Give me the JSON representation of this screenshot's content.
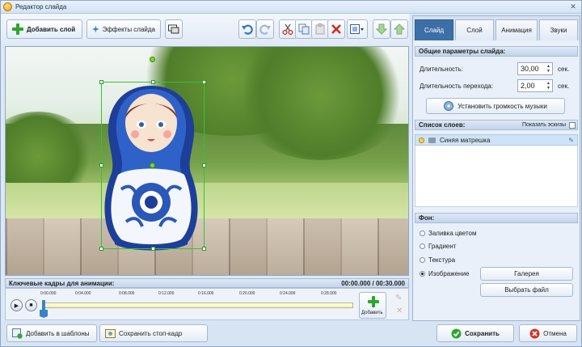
{
  "window": {
    "title": "Редактор слайда",
    "close": "✕"
  },
  "toolbar": {
    "add_layer": "Добавить слой",
    "slide_effects": "Эффекты слайда"
  },
  "tabs": [
    {
      "label": "Слайд",
      "active": true
    },
    {
      "label": "Слой",
      "active": false
    },
    {
      "label": "Анимация",
      "active": false
    },
    {
      "label": "Звуки",
      "active": false
    }
  ],
  "slide_params": {
    "header": "Общие параметры слайда:",
    "duration_label": "Длительность:",
    "duration_value": "30,00",
    "duration_unit": "сек.",
    "transition_label": "Длительность перехода:",
    "transition_value": "2,00",
    "transition_unit": "сек.",
    "music_button": "Установить громкость музыки"
  },
  "layers": {
    "header": "Список слоев:",
    "show_thumbs": "Показать эскизы",
    "items": [
      {
        "name": "Синяя матрешка"
      }
    ]
  },
  "background": {
    "header": "Фон:",
    "options": [
      {
        "label": "Заливка цветом",
        "selected": false
      },
      {
        "label": "Градиент",
        "selected": false
      },
      {
        "label": "Текстура",
        "selected": false
      },
      {
        "label": "Изображение",
        "selected": true
      }
    ],
    "gallery_button": "Галерея",
    "choose_file_button": "Выбрать файл"
  },
  "keyframes": {
    "label": "Ключевые кадры для анимации:",
    "time": "00:00.000 / 00:30.000",
    "ticks": [
      "0:00.000",
      "0:04.000",
      "0:08.000",
      "0:12.000",
      "0:16.000",
      "0:20.000",
      "0:24.000",
      "0:28.000"
    ],
    "add_label": "Добавить"
  },
  "footer": {
    "add_template": "Добавить в шаблоны",
    "save_frame": "Сохранить стоп-кадр",
    "save": "Сохранить",
    "cancel": "Отмена"
  },
  "colors": {
    "accent": "#3c6fa5",
    "selection": "#35c235"
  }
}
